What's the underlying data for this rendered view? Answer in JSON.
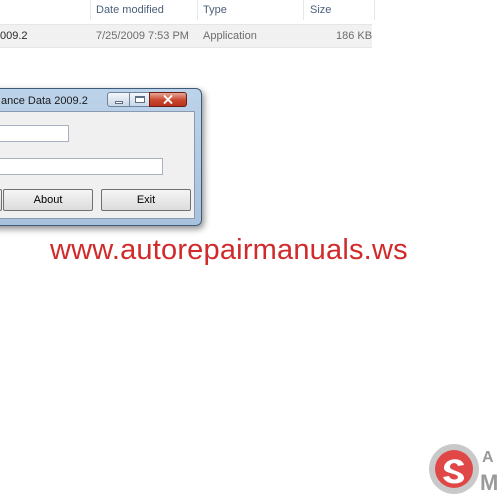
{
  "explorer": {
    "columns": {
      "date_modified": "Date modified",
      "type": "Type",
      "size": "Size"
    },
    "file_row": {
      "name": "009.2",
      "date_modified": "7/25/2009 7:53 PM",
      "type": "Application",
      "size": "186 KB"
    }
  },
  "dialog": {
    "title": "ance Data 2009.2",
    "field1_value": "",
    "field2_value": "",
    "buttons": {
      "about": "About",
      "exit": "Exit"
    },
    "caption_icons": [
      "minimize-icon",
      "maximize-icon",
      "close-icon"
    ]
  },
  "watermark": {
    "text": "www.autorepairmanuals.ws",
    "logo_letters": "A M",
    "color": "#d12a2a"
  }
}
